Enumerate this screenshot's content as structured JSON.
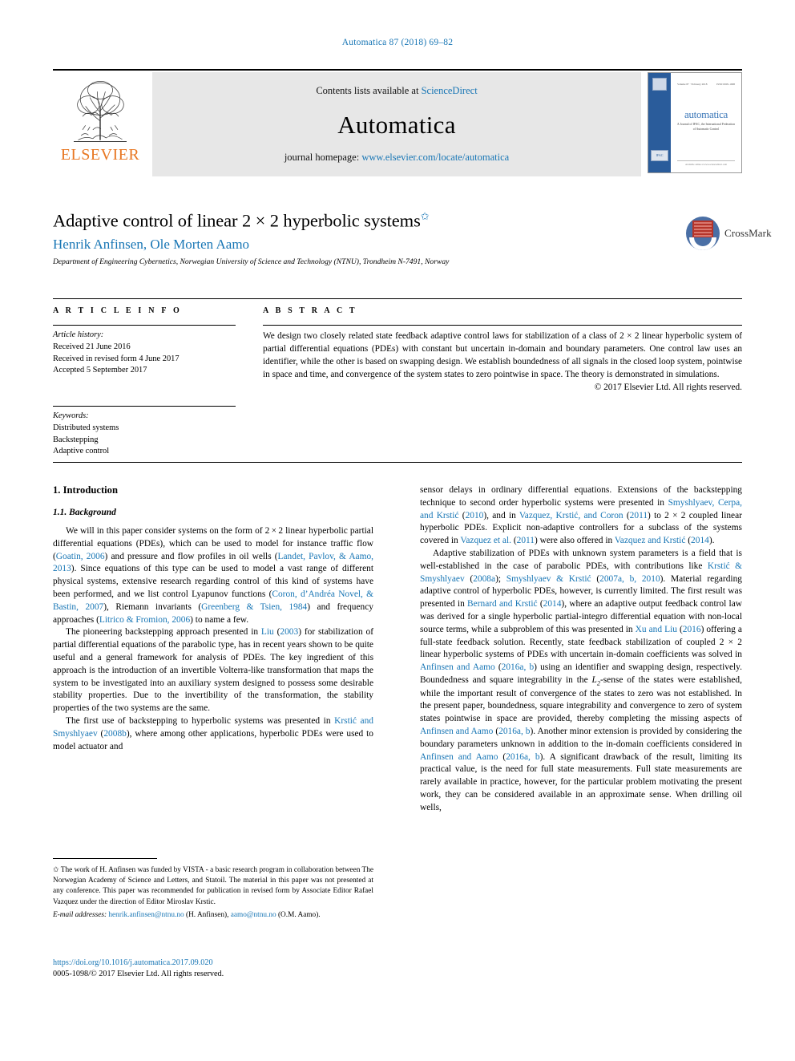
{
  "running_head": "Automatica 87 (2018) 69–82",
  "masthead": {
    "publisher_word": "ELSEVIER",
    "contents_prefix": "Contents lists available at ",
    "contents_link": "ScienceDirect",
    "journal_name": "Automatica",
    "homepage_prefix": "journal homepage: ",
    "homepage_link": "www.elsevier.com/locate/automatica",
    "cover": {
      "title": "automatica",
      "subtitle": "A Journal of IFAC, the International Federation of Automatic Control",
      "volume_line_left": "Volume 87 · February 2018",
      "volume_line_right": "ISSN 0005-1098",
      "ifac_label": "IFAC",
      "footer": "Available online at www.sciencedirect.com"
    }
  },
  "article": {
    "title": "Adaptive control of linear 2 × 2 hyperbolic systems",
    "title_star": "✩",
    "authors": "Henrik Anfinsen, Ole Morten Aamo",
    "affiliation": "Department of Engineering Cybernetics, Norwegian University of Science and Technology (NTNU), Trondheim N-7491, Norway",
    "crossmark_label": "CrossMark"
  },
  "article_info": {
    "heading": "A R T I C L E   I N F O",
    "history_label": "Article history:",
    "history": [
      "Received 21 June 2016",
      "Received in revised form 4 June 2017",
      "Accepted 5 September 2017"
    ],
    "keywords_label": "Keywords:",
    "keywords": [
      "Distributed systems",
      "Backstepping",
      "Adaptive control"
    ]
  },
  "abstract": {
    "heading": "A B S T R A C T",
    "text": "We design two closely related state feedback adaptive control laws for stabilization of a class of 2 × 2 linear hyperbolic system of partial differential equations (PDEs) with constant but uncertain in-domain and boundary parameters. One control law uses an identifier, while the other is based on swapping design. We establish boundedness of all signals in the closed loop system, pointwise in space and time, and convergence of the system states to zero pointwise in space. The theory is demonstrated in simulations.",
    "copyright": "© 2017 Elsevier Ltd. All rights reserved."
  },
  "body": {
    "section_heading": "1. Introduction",
    "subsection_heading": "1.1. Background",
    "left_paragraphs": [
      "We will in this paper consider systems on the form of 2×2 linear hyperbolic partial differential equations (PDEs), which can be used to model for instance traffic flow (Goatin, 2006) and pressure and flow profiles in oil wells (Landet, Pavlov, & Aamo, 2013). Since equations of this type can be used to model a vast range of different physical systems, extensive research regarding control of this kind of systems have been performed, and we list control Lyapunov functions (Coron, d'Andréa Novel, & Bastin, 2007), Riemann invariants (Greenberg & Tsien, 1984) and frequency approaches (Litrico & Fromion, 2006) to name a few.",
      "The pioneering backstepping approach presented in Liu (2003) for stabilization of partial differential equations of the parabolic type, has in recent years shown to be quite useful and a general framework for analysis of PDEs. The key ingredient of this approach is the introduction of an invertible Volterra-like transformation that maps the system to be investigated into an auxiliary system designed to possess some desirable stability properties. Due to the invertibility of the transformation, the stability properties of the two systems are the same.",
      "The first use of backstepping to hyperbolic systems was presented in Krstić and Smyshlyaev (2008b), where among other applications, hyperbolic PDEs were used to model actuator and"
    ],
    "right_paragraphs": [
      "sensor delays in ordinary differential equations. Extensions of the backstepping technique to second order hyperbolic systems were presented in Smyshlyaev, Cerpa, and Krstić (2010), and in Vazquez, Krstić, and Coron (2011) to 2 × 2 coupled linear hyperbolic PDEs. Explicit non-adaptive controllers for a subclass of the systems covered in Vazquez et al. (2011) were also offered in Vazquez and Krstić (2014).",
      "Adaptive stabilization of PDEs with unknown system parameters is a field that is well-established in the case of parabolic PDEs, with contributions like Krstić & Smyshlyaev (2008a); Smyshlyaev & Krstić (2007a, b, 2010). Material regarding adaptive control of hyperbolic PDEs, however, is currently limited. The first result was presented in Bernard and Krstić (2014), where an adaptive output feedback control law was derived for a single hyperbolic partial-integro differential equation with non-local source terms, while a subproblem of this was presented in Xu and Liu (2016) offering a full-state feedback solution. Recently, state feedback stabilization of coupled 2 × 2 linear hyperbolic systems of PDEs with uncertain in-domain coefficients was solved in Anfinsen and Aamo (2016a, b) using an identifier and swapping design, respectively. Boundedness and square integrability in the L2-sense of the states were established, while the important result of convergence of the states to zero was not established. In the present paper, boundedness, square integrability and convergence to zero of system states pointwise in space are provided, thereby completing the missing aspects of Anfinsen and Aamo (2016a, b). Another minor extension is provided by considering the boundary parameters unknown in addition to the in-domain coefficients considered in Anfinsen and Aamo (2016a, b). A significant drawback of the result, limiting its practical value, is the need for full state measurements. Full state measurements are rarely available in practice, however, for the particular problem motivating the present work, they can be considered available in an approximate sense. When drilling oil wells,"
    ]
  },
  "footnote": {
    "star": "✩",
    "text": "The work of H. Anfinsen was funded by VISTA - a basic research program in collaboration between The Norwegian Academy of Science and Letters, and Statoil. The material in this paper was not presented at any conference. This paper was recommended for publication in revised form by Associate Editor Rafael Vazquez under the direction of Editor Miroslav Krstic.",
    "email_label": "E-mail addresses:",
    "email_1": "henrik.anfinsen@ntnu.no",
    "email_1_owner": "(H. Anfinsen),",
    "email_2": "aamo@ntnu.no",
    "email_2_owner": "(O.M. Aamo)."
  },
  "doi": {
    "link": "https://doi.org/10.1016/j.automatica.2017.09.020",
    "issn": "0005-1098/© 2017 Elsevier Ltd. All rights reserved."
  },
  "colors": {
    "link": "#1876b5",
    "elsevier_orange": "#e87722",
    "masthead_grey": "#e7e7e7",
    "cover_blue": "#2a5c9b"
  }
}
